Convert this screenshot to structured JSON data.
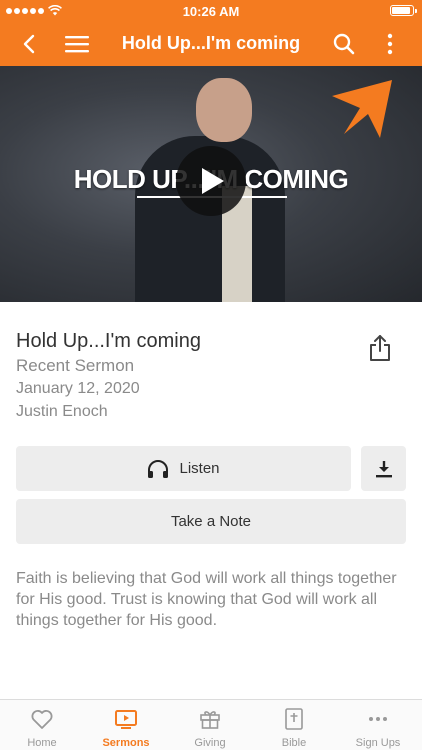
{
  "status_bar": {
    "time": "10:26 AM"
  },
  "nav": {
    "title": "Hold Up...I'm coming"
  },
  "hero": {
    "title": "HOLD UP...I'M COMING"
  },
  "sermon": {
    "title": "Hold Up...I'm coming",
    "category": "Recent Sermon",
    "date": "January 12, 2020",
    "speaker": "Justin Enoch",
    "description": "Faith is believing that God will work all things together for His good. Trust is knowing that God will work all things together for His good."
  },
  "actions": {
    "listen_label": "Listen",
    "note_label": "Take a Note"
  },
  "tabs": [
    {
      "label": "Home",
      "icon": "heart-icon",
      "active": false
    },
    {
      "label": "Sermons",
      "icon": "tv-icon",
      "active": true
    },
    {
      "label": "Giving",
      "icon": "gift-icon",
      "active": false
    },
    {
      "label": "Bible",
      "icon": "bible-icon",
      "active": false
    },
    {
      "label": "Sign Ups",
      "icon": "more-dots-icon",
      "active": false
    }
  ],
  "colors": {
    "accent": "#f47b20",
    "muted_text": "#8a8a8a",
    "button_bg": "#ededed"
  }
}
